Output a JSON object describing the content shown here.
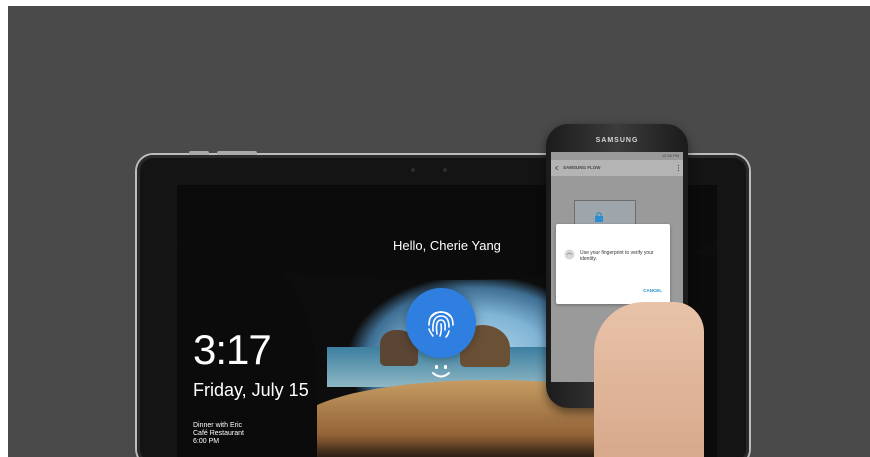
{
  "lock_screen": {
    "greeting": "Hello, Cherie Yang",
    "time": "3:17",
    "date": "Friday, July 15",
    "event": {
      "title": "Dinner with Eric",
      "location": "Café Restaurant",
      "time": "6:00 PM"
    },
    "fingerprint_color": "#2f7fe0"
  },
  "phone": {
    "brand": "SAMSUNG",
    "status_time": "12:45 PM",
    "app_title": "SAMSUNG FLOW",
    "dialog_message": "Use your fingerprint to verify your identity.",
    "dialog_cancel": "CANCEL",
    "accent": "#2a8ecf"
  },
  "icons": [
    "smiley-icon",
    "fingerprint-icon",
    "lock-icon",
    "back-arrow-icon",
    "more-options-icon"
  ]
}
